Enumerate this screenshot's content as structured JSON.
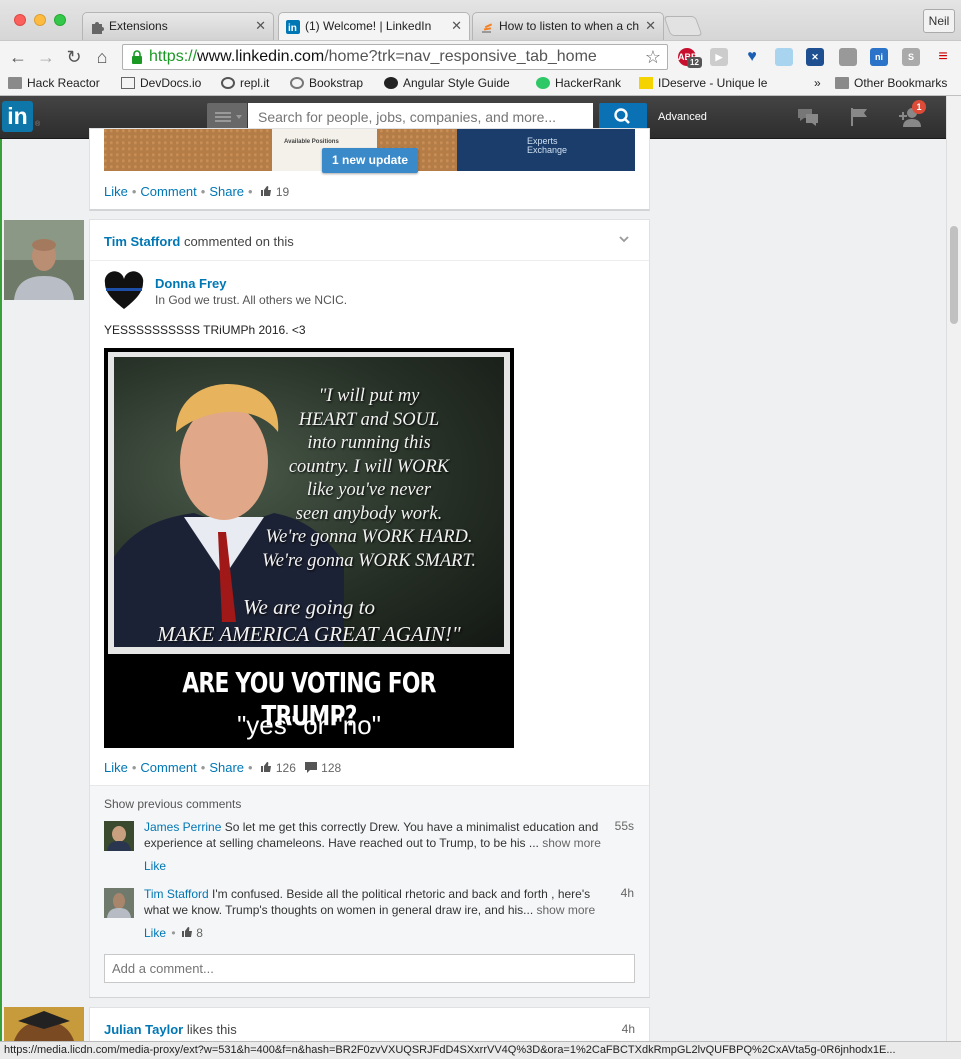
{
  "browser": {
    "tabs": [
      {
        "label": "Extensions"
      },
      {
        "label": "(1) Welcome! | LinkedIn"
      },
      {
        "label": "How to listen to when a ch"
      }
    ],
    "user_button": "Neil",
    "url_scheme": "https://",
    "url_host": "www.linkedin.com",
    "url_rest": "/home?trk=nav_responsive_tab_home",
    "extension_badge": "12",
    "bookmarks": [
      {
        "label": "Hack Reactor"
      },
      {
        "label": "DevDocs.io"
      },
      {
        "label": "repl.it"
      },
      {
        "label": "Bookstrap"
      },
      {
        "label": "Angular Style Guide"
      },
      {
        "label": "HackerRank"
      },
      {
        "label": "IDeserve - Unique le"
      }
    ],
    "bookmarks_overflow": "»",
    "other_bookmarks": "Other Bookmarks",
    "status_url": "https://media.licdn.com/media-proxy/ext?w=531&h=400&f=n&hash=BR2F0zvVXUQSRJFdD4SXxrrVV4Q%3D&ora=1%2CaFBCTXdkRmpGL2lvQUFBPQ%2CxAVta5g-0R6jnhodx1E..."
  },
  "linkedin_header": {
    "logo_text": "in",
    "logo_suffix": "®",
    "search_placeholder": "Search for people, jobs, companies, and more...",
    "advanced_label": "Advanced",
    "notification_count": "1"
  },
  "top_card": {
    "ad_paper_text": "Available Positions",
    "ad_brand_line1": "Experts",
    "ad_brand_line2": "Exchange",
    "new_update_label": "1 new update",
    "like_label": "Like",
    "comment_label": "Comment",
    "share_label": "Share",
    "like_count": "19"
  },
  "main_card": {
    "actor_name": "Tim Stafford",
    "actor_action": " commented on this",
    "author_name": "Donna Frey",
    "author_headline": "In God we trust. All others we NCIC.",
    "post_text": "YESSSSSSSSSS TRiUMPh 2016. <3",
    "image": {
      "quote": "\"I will put my\nHEART and SOUL\ninto running this\ncountry. I will WORK\nlike you've never\nseen anybody work.\nWe're gonna WORK HARD.\nWe're gonna WORK SMART.",
      "quote_bottom": "We are going to\nMAKE AMERICA  GREAT AGAIN!\"",
      "headline": "ARE YOU VOTING FOR TRUMP?",
      "answer": "\"yes\" or \"no\""
    },
    "like_label": "Like",
    "comment_label": "Comment",
    "share_label": "Share",
    "like_count": "126",
    "comment_count": "128",
    "show_previous": "Show previous comments",
    "comments": [
      {
        "name": "James Perrine",
        "text": " So let me get this correctly Drew. You have a minimalist education and experience at selling chameleons. Have reached out to Trump, to be his ... ",
        "more": "show more",
        "time": "55s",
        "like_label": "Like",
        "like_count": ""
      },
      {
        "name": "Tim Stafford",
        "text": " I'm confused. Beside all the political rhetoric and back and forth , here's what we know. Trump's thoughts on women in general draw ire, and his... ",
        "more": "show more",
        "time": "4h",
        "like_label": "Like",
        "like_count": "8"
      }
    ],
    "add_comment_placeholder": "Add a comment..."
  },
  "bottom_card": {
    "actor_name": "Julian Taylor",
    "actor_action": " likes this",
    "time": "4h"
  },
  "colors": {
    "linkedin_blue": "#0077b5",
    "header_dark": "#333333",
    "search_button": "#0b71b5",
    "badge_red": "#dd4b39"
  }
}
